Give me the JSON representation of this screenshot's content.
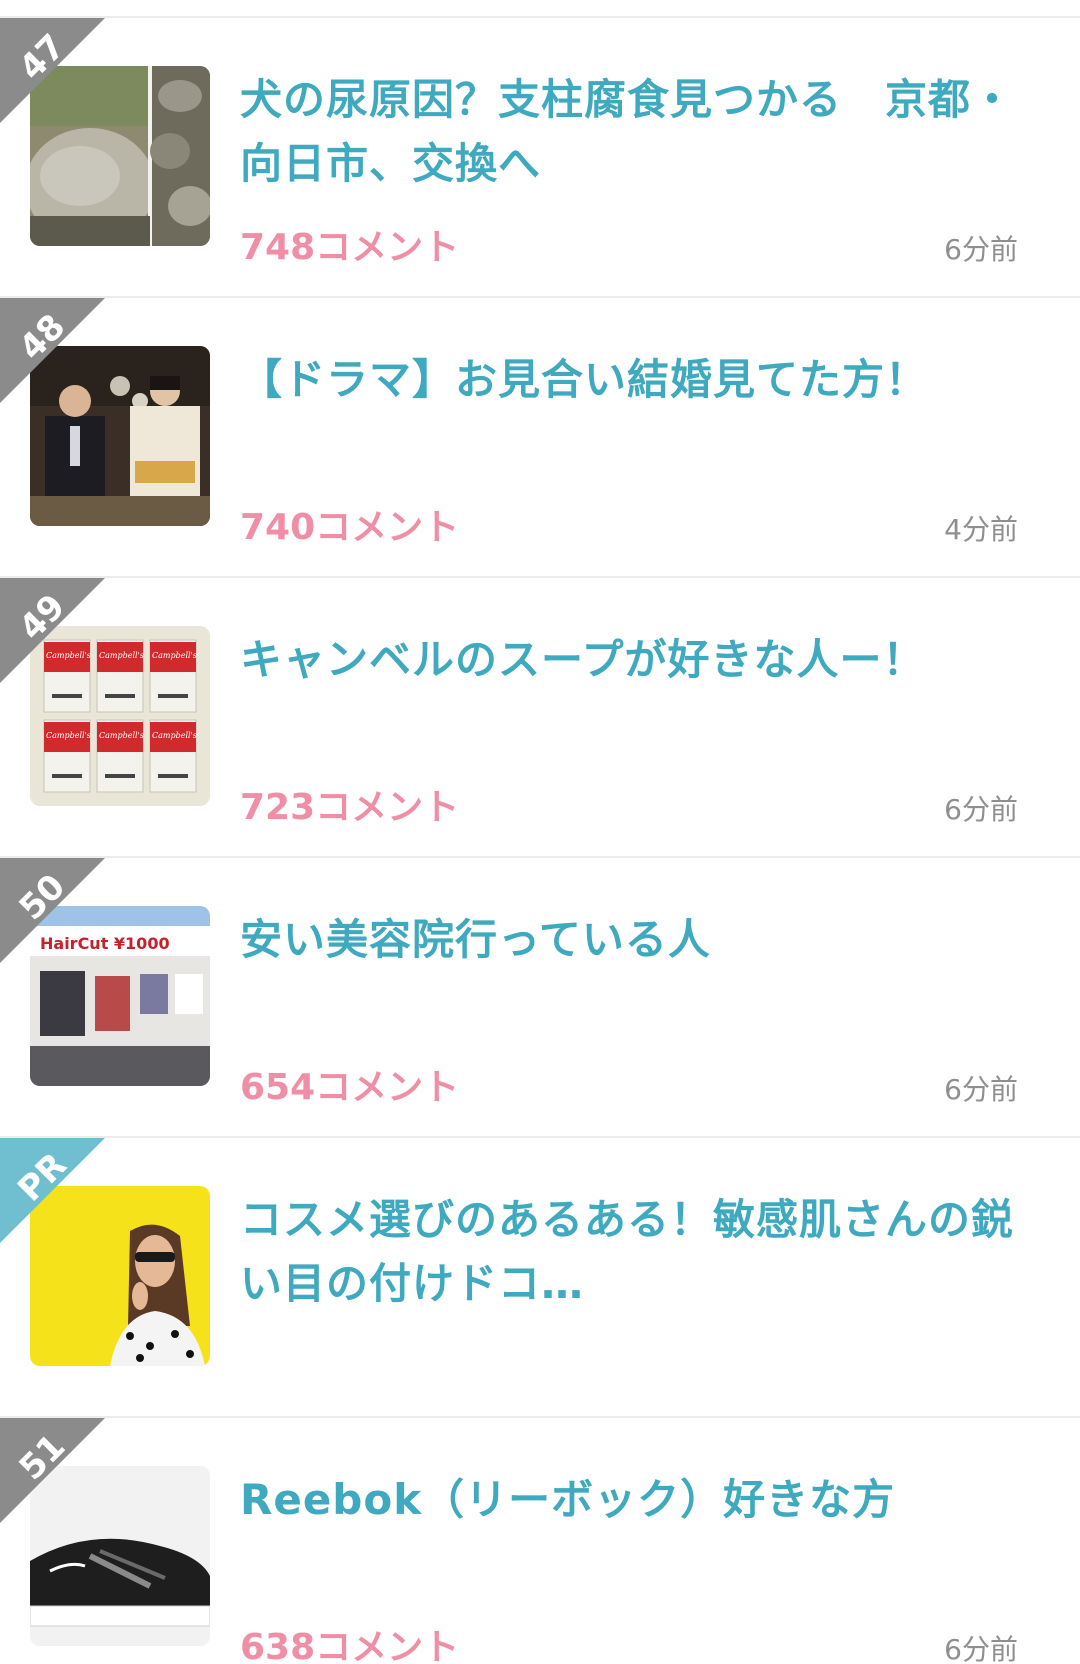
{
  "comment_color": "#f08ea6",
  "title_color": "#3ea9bf",
  "pr_badge_color": "#6fbfd0",
  "rank_badge_color": "#8b8b8b",
  "items": [
    {
      "rank": "47",
      "title": "犬の尿原因？支柱腐食見つかる　京都・向日市、交換へ",
      "comments": "748コメント",
      "time": "6分前",
      "thumbnail": "stone-pillar-photo"
    },
    {
      "rank": "48",
      "title": "【ドラマ】お見合い結婚見てた方！",
      "comments": "740コメント",
      "time": "4分前",
      "thumbnail": "couple-kimono-photo"
    },
    {
      "rank": "49",
      "title": "キャンベルのスープが好きな人ー！",
      "comments": "723コメント",
      "time": "6分前",
      "thumbnail": "soup-cans-photo",
      "thumbnail_text": "Campbell's"
    },
    {
      "rank": "50",
      "title": "安い美容院行っている人",
      "comments": "654コメント",
      "time": "6分前",
      "thumbnail": "haircut-shop-photo",
      "thumbnail_text": "HairCut ¥1000"
    },
    {
      "rank": "PR",
      "title": "コスメ選びのあるある！敏感肌さんの鋭い目の付けドコ…",
      "comments": "",
      "time": "",
      "thumbnail": "woman-yellow-background-photo"
    },
    {
      "rank": "51",
      "title": "Reebok（リーボック）好きな方",
      "comments": "638コメント",
      "time": "6分前",
      "thumbnail": "sneaker-photo"
    }
  ]
}
